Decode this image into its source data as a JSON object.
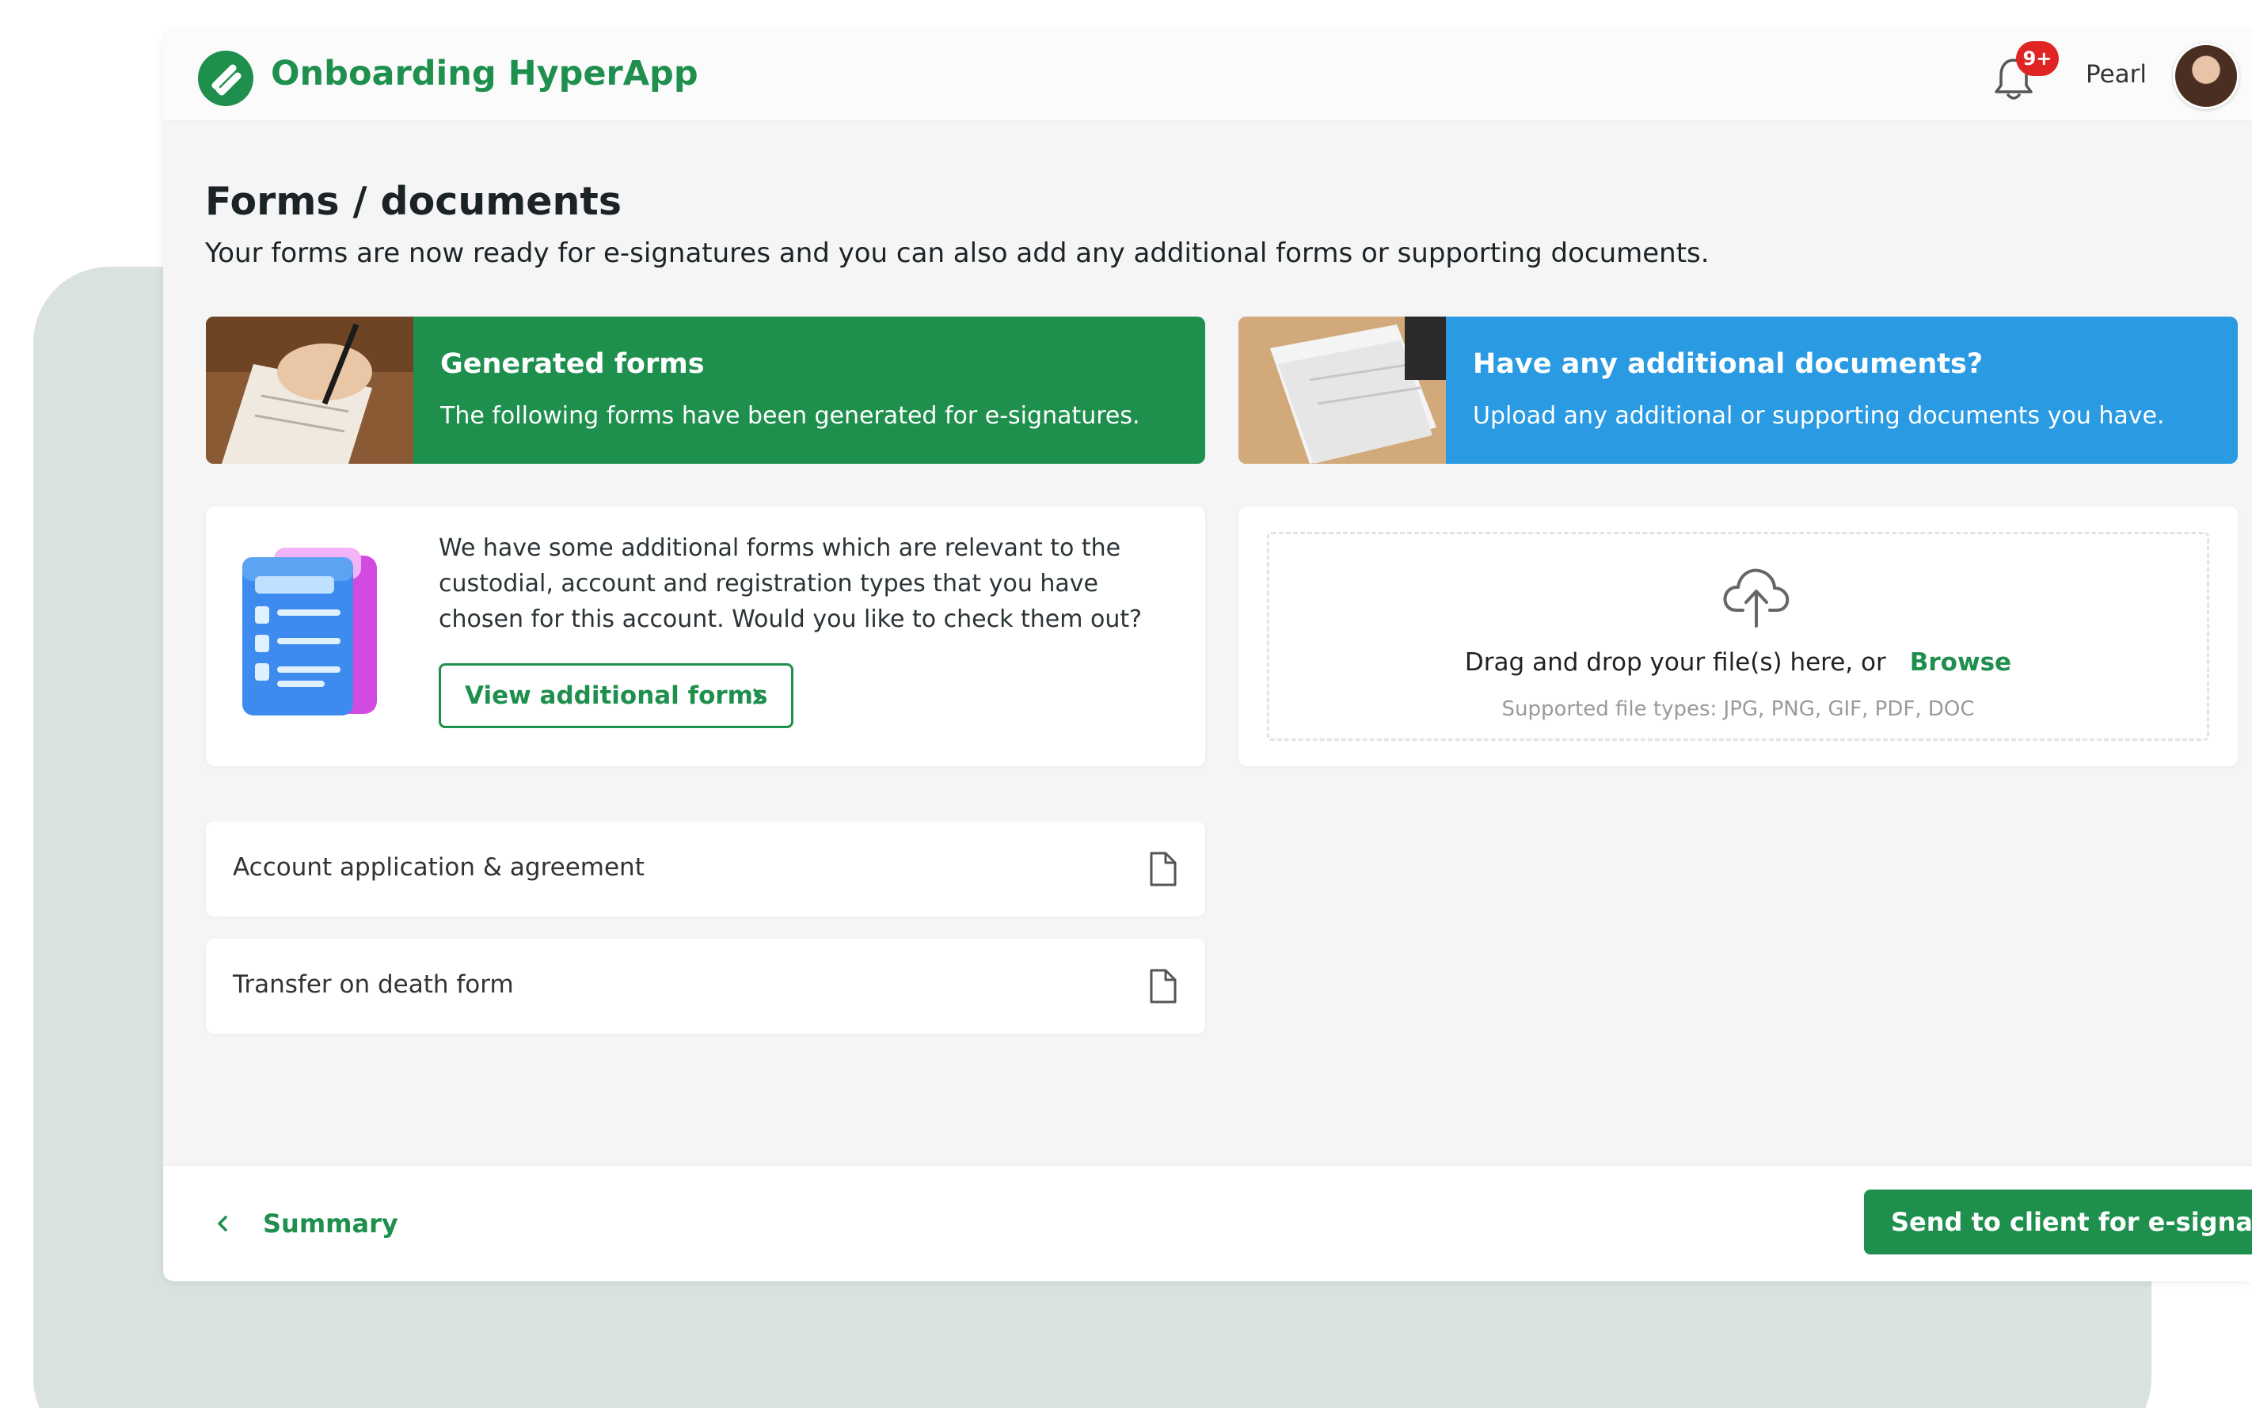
{
  "app": {
    "title": "Onboarding HyperApp",
    "notifications_count": "9+",
    "user_name": "Pearl",
    "brand_color": "#1f8f4e",
    "accent_blue": "#2a9ae2",
    "badge_color": "#e02424"
  },
  "page": {
    "title": "Forms / documents",
    "subtitle": "Your forms are now ready for e-signatures and you can also add any additional forms or supporting documents."
  },
  "generated_banner": {
    "title": "Generated forms",
    "description": "The following forms have been generated for e-signatures."
  },
  "additional_banner": {
    "title": "Have any additional documents?",
    "description": "Upload any additional or supporting documents you have."
  },
  "additional_forms_card": {
    "text": "We have some additional forms which are relevant to the custodial, account and registration types that you have chosen for this account. Would you like to check them out?",
    "button_label": "View additional forms"
  },
  "upload": {
    "prompt": "Drag and drop your file(s) here, or",
    "browse_label": "Browse",
    "file_types": "Supported file types: JPG, PNG, GIF, PDF, DOC"
  },
  "documents": [
    {
      "label": "Account application & agreement",
      "icon": "document-icon"
    },
    {
      "label": "Transfer on death form",
      "icon": "document-icon"
    }
  ],
  "footer": {
    "back_label": "Summary",
    "primary_label": "Send to client for e-signature"
  }
}
